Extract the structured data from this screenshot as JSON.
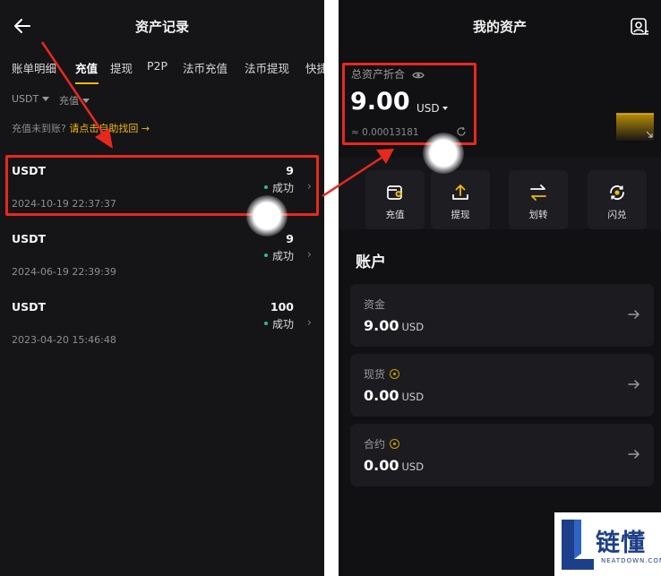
{
  "left_screen": {
    "title": "资产记录",
    "tabs": [
      "账单明细",
      "充值",
      "提现",
      "P2P",
      "法币充值",
      "法币提现",
      "快捷"
    ],
    "active_tab": "充值",
    "filters": {
      "coin": "USDT",
      "type": "充值"
    },
    "hint": {
      "question": "充值未到账?",
      "link": "请点击自助找回 →"
    },
    "records": [
      {
        "coin": "USDT",
        "amount": "9",
        "status": "成功",
        "time": "2024-10-19 22:37:37"
      },
      {
        "coin": "USDT",
        "amount": "9",
        "status": "成功",
        "time": "2024-06-19 22:39:39"
      },
      {
        "coin": "USDT",
        "amount": "100",
        "status": "成功",
        "time": "2023-04-20 15:46:48"
      }
    ]
  },
  "right_screen": {
    "title": "我的资产",
    "total_label": "总资产折合",
    "total_value": "9.00",
    "total_currency": "USD",
    "btc_equivalent": "≈ 0.00013181",
    "actions": [
      {
        "label": "充值",
        "icon": "deposit-icon"
      },
      {
        "label": "提现",
        "icon": "withdraw-icon"
      },
      {
        "label": "划转",
        "icon": "transfer-icon"
      },
      {
        "label": "闪兑",
        "icon": "convert-icon"
      }
    ],
    "section_title": "账户",
    "accounts": [
      {
        "name": "资金",
        "value": "9.00",
        "currency": "USD"
      },
      {
        "name": "现货",
        "value": "0.00",
        "currency": "USD"
      },
      {
        "name": "合约",
        "value": "0.00",
        "currency": "USD"
      }
    ]
  },
  "watermark": {
    "cn": "链懂",
    "en": "NEATDOWN.COM"
  },
  "colors": {
    "accent": "#f0b90b",
    "success": "#2ebd85",
    "highlight": "#e8281e",
    "background": "#151518"
  }
}
